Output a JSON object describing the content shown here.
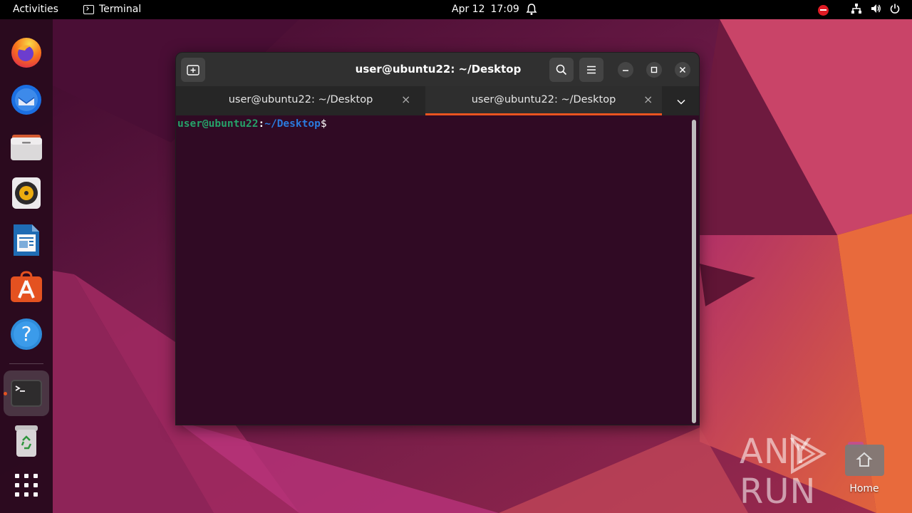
{
  "topbar": {
    "activities": "Activities",
    "app_name": "Terminal",
    "date": "Apr 12",
    "time": "17:09",
    "icons": [
      "bell-icon",
      "do-not-disturb-icon",
      "network-icon",
      "volume-icon",
      "power-icon"
    ]
  },
  "dock": {
    "items": [
      {
        "name": "Firefox",
        "icon": "firefox-icon"
      },
      {
        "name": "Thunderbird",
        "icon": "thunderbird-icon"
      },
      {
        "name": "Files",
        "icon": "files-icon"
      },
      {
        "name": "Rhythmbox",
        "icon": "rhythmbox-icon"
      },
      {
        "name": "LibreOffice Writer",
        "icon": "writer-icon"
      },
      {
        "name": "Ubuntu Software",
        "icon": "software-icon"
      },
      {
        "name": "Help",
        "icon": "help-icon"
      },
      {
        "name": "Terminal",
        "icon": "terminal-icon",
        "running": true
      },
      {
        "name": "Trash",
        "icon": "trash-icon"
      },
      {
        "name": "Show Applications",
        "icon": "app-grid-icon"
      }
    ]
  },
  "window": {
    "title": "user@ubuntu22: ~/Desktop",
    "tabs": [
      {
        "label": "user@ubuntu22: ~/Desktop",
        "active": false
      },
      {
        "label": "user@ubuntu22: ~/Desktop",
        "active": true
      }
    ],
    "tab_close": "×",
    "prompt": {
      "user_host": "user@ubuntu22",
      "colon": ":",
      "path": "~/Desktop",
      "symbol": "$"
    }
  },
  "desktop": {
    "watermark": "ANY RUN",
    "home_label": "Home"
  },
  "colors": {
    "terminal_bg": "#300a24",
    "accent": "#e95420",
    "prompt_user": "#26a269",
    "prompt_path": "#2a7bde"
  }
}
